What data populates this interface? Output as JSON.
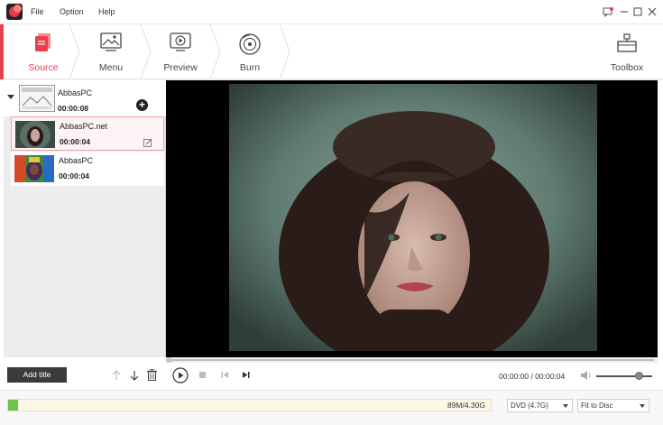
{
  "menubar": {
    "items": [
      "File",
      "Option",
      "Help"
    ]
  },
  "steps": [
    {
      "label": "Source",
      "active": true,
      "icon": "source-file-icon"
    },
    {
      "label": "Menu",
      "active": false,
      "icon": "image-menu-icon"
    },
    {
      "label": "Preview",
      "active": false,
      "icon": "monitor-play-icon"
    },
    {
      "label": "Burn",
      "active": false,
      "icon": "disc-burn-icon"
    }
  ],
  "toolbox": {
    "label": "Toolbox",
    "icon": "toolbox-icon"
  },
  "title_group": {
    "name": "AbbasPC",
    "duration": "00:00:08"
  },
  "clips": [
    {
      "name": "AbbasPC.net",
      "duration": "00:00:04",
      "selected": true
    },
    {
      "name": "AbbasPC",
      "duration": "00:00:04",
      "selected": false
    }
  ],
  "player": {
    "add_title_label": "Add title",
    "timecode": "00:00:00 / 00:00:04",
    "volume": 0.75,
    "position": 0.0
  },
  "disc": {
    "usage_text": "89M/4.30G",
    "usage_fraction": 0.02,
    "disc_type": "DVD (4.7G)",
    "fit_mode": "Fit to Disc"
  },
  "colors": {
    "accent": "#e8404e",
    "usage_fill": "#6cc24a",
    "add_title_bg": "#3b3b3b"
  }
}
